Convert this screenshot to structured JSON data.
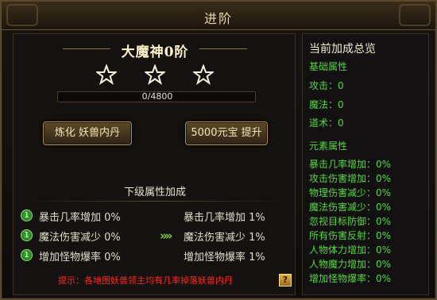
{
  "window": {
    "title": "进阶"
  },
  "boss": {
    "name": "大魔神0阶",
    "stars_total": 3,
    "stars_filled": 0
  },
  "progress": {
    "text": "0/4800",
    "current": 0,
    "max": 4800
  },
  "buttons": {
    "refine": "炼化 妖兽内丹",
    "promote": "5000元宝 提升",
    "help": "?"
  },
  "next_level": {
    "title": "下级属性加成",
    "rows": [
      {
        "badge": "1",
        "current": "暴击几率增加 0%",
        "next": "暴击几率增加 1%"
      },
      {
        "badge": "1",
        "current": "魔法伤害减少 0%",
        "next": "魔法伤害减少 1%"
      },
      {
        "badge": "1",
        "current": "增加怪物爆率 0%",
        "next": "增加怪物爆率 1%"
      }
    ],
    "arrow": "»»"
  },
  "tip": "提示：各地图妖兽领主均有几率掉落妖兽内丹",
  "summary": {
    "title": "当前加成总览",
    "basic_title": "基础属性",
    "basic": [
      "攻击：0",
      "魔法：0",
      "道术：0"
    ],
    "element_title": "元素属性",
    "element": [
      "暴击几率增加：0%",
      "攻击伤害增加：0%",
      "物理伤害减少：0%",
      "魔法伤害减少：0%",
      "忽视目标防御：0%",
      "所有伤害反射：0%",
      "人物体力增加：0%",
      "人物魔力增加：0%",
      "增加怪物爆率：0%"
    ]
  },
  "colors": {
    "green_text": "#55d840",
    "red_tip": "#ff2a1a",
    "gold_border": "#b09050"
  }
}
